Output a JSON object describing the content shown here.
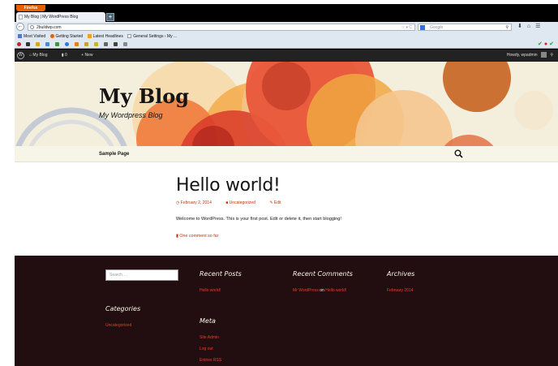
{
  "browser": {
    "firefox_button": "Firefox",
    "tab_title": "My Blog | My WordPress Blog",
    "new_tab": "+",
    "url": "2buildwp.com",
    "url_controls": "☆ ▾ C",
    "search_placeholder": "Google",
    "nav_icons": [
      "⬇",
      "⌂",
      "☰"
    ],
    "bookmarks": [
      "Most Visited",
      "Getting Started",
      "Latest Headlines",
      "General Settings ‹ My ..."
    ]
  },
  "admin_bar": {
    "site_name": "My Blog",
    "comments_count": "0",
    "new_label": "New",
    "howdy": "Howdy, wpadmin"
  },
  "header": {
    "site_title": "My Blog",
    "site_description": "My Wordpress Blog"
  },
  "menu": {
    "items": [
      "Sample Page"
    ]
  },
  "post": {
    "title": "Hello world!",
    "date": "February 2, 2014",
    "category": "Uncategorized",
    "edit": "Edit",
    "content": "Welcome to WordPress. This is your first post. Edit or delete it, then start blogging!",
    "comments": "One comment so far"
  },
  "footer": {
    "search_placeholder": "Search …",
    "recent_posts": {
      "title": "Recent Posts",
      "items": [
        "Hello world!"
      ]
    },
    "recent_comments": {
      "title": "Recent Comments",
      "author": "Mr WordPress",
      "on": "on",
      "post": "Hello world!"
    },
    "archives": {
      "title": "Archives",
      "items": [
        "February 2014"
      ]
    },
    "categories": {
      "title": "Categories",
      "items": [
        "Uncategorized"
      ]
    },
    "meta": {
      "title": "Meta",
      "items": [
        "Site Admin",
        "Log out",
        "Entries RSS"
      ]
    }
  },
  "colors": {
    "accent": "#bc360a",
    "link_footer": "#e63f2a",
    "footer_bg": "#220e10",
    "header_bg": "#f4eedc"
  }
}
